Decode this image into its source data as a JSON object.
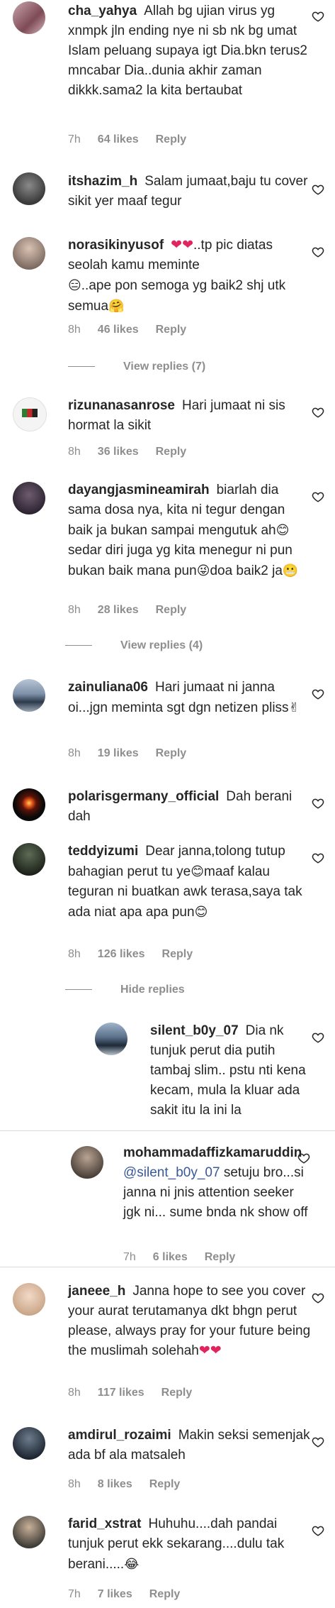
{
  "comments": [
    {
      "user": "cha_yahya",
      "text": "Allah bg ujian virus yg xnmpk jln ending nye ni sb nk bg umat Islam peluang supaya igt Dia.bkn terus2 mncabar Dia..dunia akhir zaman dikkk.sama2 la kita bertaubat",
      "time": "7h",
      "likes": "64 likes",
      "reply": "Reply"
    },
    {
      "user": "itshazim_h",
      "text": "Salam jumaat,baju tu cover sikit yer maaf tegur"
    },
    {
      "user": "norasikinyusof",
      "text": "..tp pic diatas seolah kamu meminte",
      "text2": "..ape pon semoga yg baik2 shj utk semua",
      "time": "8h",
      "likes": "46 likes",
      "reply": "Reply",
      "view_replies": "View replies (7)"
    },
    {
      "user": "rizunanasanrose",
      "text": "Hari jumaat ni sis hormat la sikit",
      "time": "8h",
      "likes": "36 likes",
      "reply": "Reply"
    },
    {
      "user": "dayangjasmineamirah",
      "text": "biarlah dia sama dosa nya, kita ni tegur dengan baik ja bukan sampai mengutuk ah",
      "text2": "sedar diri juga yg kita menegur ni pun bukan baik mana pun",
      "text3": "doa baik2 ja",
      "time": "8h",
      "likes": "28 likes",
      "reply": "Reply",
      "view_replies": "View replies (4)"
    },
    {
      "user": "zainuliana06",
      "text": "Hari jumaat ni janna oi...jgn meminta sgt dgn netizen pliss",
      "time": "8h",
      "likes": "19 likes",
      "reply": "Reply"
    },
    {
      "user": "polarisgermany_official",
      "text": "Dah berani dah"
    },
    {
      "user": "teddyizumi",
      "text": "Dear janna,tolong tutup bahagian perut tu ye",
      "text2": "maaf kalau teguran ni buatkan awk terasa,saya tak ada niat apa apa pun",
      "time": "8h",
      "likes": "126 likes",
      "reply": "Reply",
      "hide_replies": "Hide replies"
    },
    {
      "user": "silent_b0y_07",
      "text": "Dia nk tunjuk perut dia putih tambaj slim.. pstu nti kena kecam, mula la kluar ada sakit itu la ini la"
    },
    {
      "user": "mohammadaffizkamaruddin",
      "mention": "@silent_b0y_07",
      "text": "setuju bro...si janna ni jnis attention seeker jgk ni... sume bnda nk show off",
      "time": "7h",
      "likes": "6 likes",
      "reply": "Reply"
    },
    {
      "user": "janeee_h",
      "text": "Janna hope to see you cover your aurat terutamanya dkt bhgn perut please, always pray for your future being the muslimah solehah",
      "time": "8h",
      "likes": "117 likes",
      "reply": "Reply"
    },
    {
      "user": "amdirul_rozaimi",
      "text": "Makin seksi semenjak ada bf ala matsaleh",
      "time": "8h",
      "likes": "8 likes",
      "reply": "Reply"
    },
    {
      "user": "farid_xstrat",
      "text": "Huhuhu....dah pandai tunjuk perut ekk sekarang....dulu tak berani.....",
      "time": "7h",
      "likes": "7 likes",
      "reply": "Reply"
    }
  ],
  "colors": {
    "text": "#262626",
    "meta": "#8e8e8e",
    "heart": "#262626",
    "emoji_heart": "#e0245e"
  }
}
